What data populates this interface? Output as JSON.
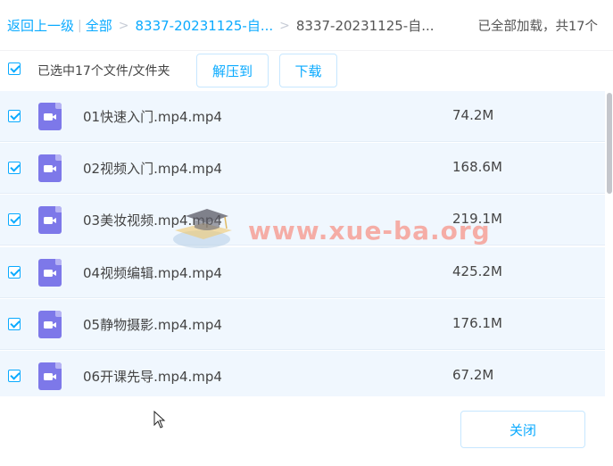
{
  "breadcrumb": {
    "back": "返回上一级",
    "all": "全部",
    "folder_link": "8337-20231125-自...",
    "folder_current": "8337-20231125-自...",
    "status": "已全部加载，共17个"
  },
  "toolbar": {
    "selected_text": "已选中17个文件/文件夹",
    "extract_label": "解压到",
    "download_label": "下载"
  },
  "files": [
    {
      "name": "01快速入门.mp4.mp4",
      "size": "74.2M",
      "checked": true
    },
    {
      "name": "02视频入门.mp4.mp4",
      "size": "168.6M",
      "checked": true
    },
    {
      "name": "03美妆视频.mp4.mp4",
      "size": "219.1M",
      "checked": true
    },
    {
      "name": "04视频编辑.mp4.mp4",
      "size": "425.2M",
      "checked": true
    },
    {
      "name": "05静物摄影.mp4.mp4",
      "size": "176.1M",
      "checked": true
    },
    {
      "name": "06开课先导.mp4.mp4",
      "size": "67.2M",
      "checked": true
    }
  ],
  "watermark": {
    "text": "www.xue-ba.org"
  },
  "footer": {
    "close_label": "关闭"
  },
  "colors": {
    "accent": "#09aaff",
    "row_bg": "#f0f7fe",
    "video_icon": "#7d78e9"
  },
  "icons": {
    "file_type": "video-file-icon",
    "checkbox": "checkbox-checked-icon"
  }
}
